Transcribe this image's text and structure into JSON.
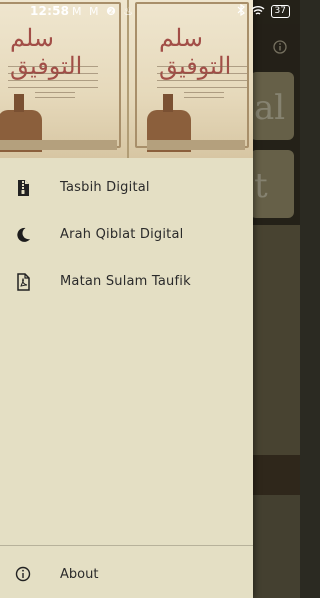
{
  "status_bar": {
    "time": "12:58",
    "notification_icons": "M M ❷ ♨",
    "battery": "37"
  },
  "background_app": {
    "card1_text": "al",
    "card2_text": "t"
  },
  "drawer": {
    "header_cover_title": "سلم التوفيق",
    "menu": [
      {
        "label": "Tasbih Digital",
        "icon": "zip-file-icon"
      },
      {
        "label": "Arah Qiblat Digital",
        "icon": "crescent-moon-icon"
      },
      {
        "label": "Matan Sulam Taufik",
        "icon": "pdf-file-icon"
      }
    ],
    "about": {
      "label": "About",
      "icon": "info-icon"
    }
  },
  "colors": {
    "drawer_bg": "#e4dfc4",
    "text": "#2b2b2b",
    "cover_title": "#9b3f3a"
  }
}
